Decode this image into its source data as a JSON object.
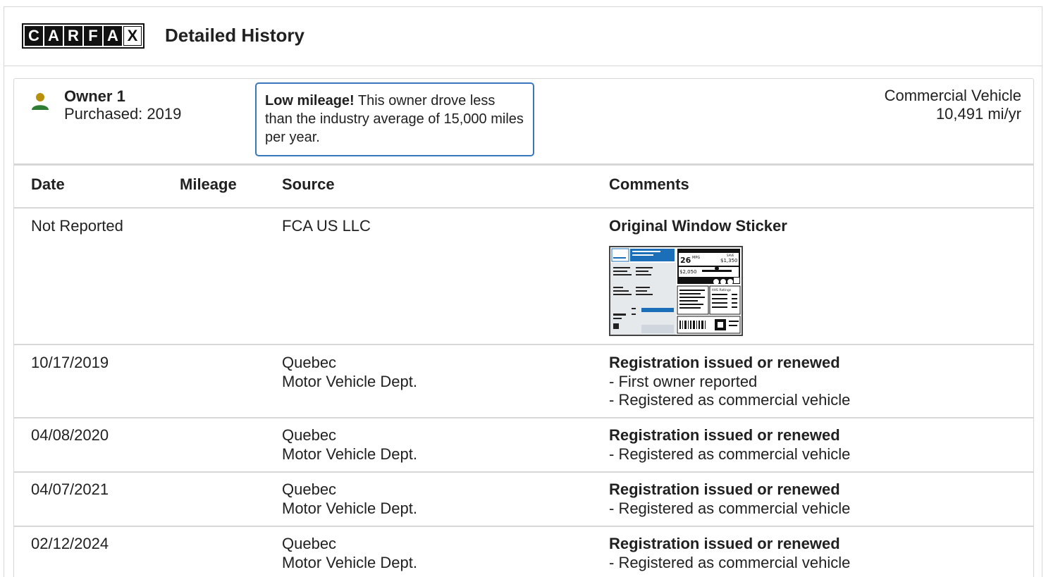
{
  "header": {
    "logo_letters": [
      "C",
      "A",
      "R",
      "F",
      "A",
      "X"
    ],
    "title": "Detailed History"
  },
  "owner": {
    "title": "Owner 1",
    "purchased": "Purchased: 2019",
    "alert_bold": "Low mileage!",
    "alert_text": " This owner drove less than the industry average of 15,000 miles per year.",
    "vehicle_type": "Commercial Vehicle",
    "mileage_rate": "10,491 mi/yr",
    "icon_color": "#2e7d32",
    "icon_head_color": "#b8900a"
  },
  "table": {
    "headers": {
      "date": "Date",
      "mileage": "Mileage",
      "source": "Source",
      "comments": "Comments"
    },
    "rows": [
      {
        "date": "Not Reported",
        "source": [
          "FCA US LLC"
        ],
        "comment_title": "Original Window Sticker",
        "comment_lines": [],
        "has_sticker": true
      },
      {
        "date": "10/17/2019",
        "source": [
          "Quebec",
          "Motor Vehicle Dept."
        ],
        "comment_title": "Registration issued or renewed",
        "comment_lines": [
          "- First owner reported",
          "- Registered as commercial vehicle"
        ]
      },
      {
        "date": "04/08/2020",
        "source": [
          "Quebec",
          "Motor Vehicle Dept."
        ],
        "comment_title": "Registration issued or renewed",
        "comment_lines": [
          "- Registered as commercial vehicle"
        ]
      },
      {
        "date": "04/07/2021",
        "source": [
          "Quebec",
          "Motor Vehicle Dept."
        ],
        "comment_title": "Registration issued or renewed",
        "comment_lines": [
          "- Registered as commercial vehicle"
        ]
      },
      {
        "date": "02/12/2024",
        "source": [
          "Quebec",
          "Motor Vehicle Dept."
        ],
        "comment_title": "Registration issued or renewed",
        "comment_lines": [
          "- Registered as commercial vehicle"
        ]
      }
    ]
  },
  "sticker": {
    "mpg": "26",
    "mpg_unit": "MPG",
    "save_label": "SAVE",
    "save_amount": "$1,350",
    "fuel_cost": "$2,050",
    "ratings_label": "IIHS Ratings"
  },
  "colors": {
    "border": "#d7d7d7",
    "accent_blue": "#3777bc",
    "text": "#212121"
  }
}
